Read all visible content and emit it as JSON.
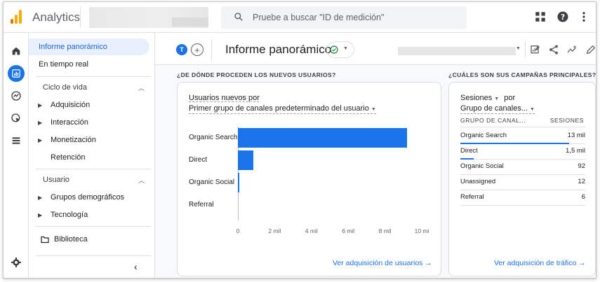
{
  "app": {
    "name": "Analytics"
  },
  "search": {
    "placeholder": "Pruebe a buscar \"ID de medición\""
  },
  "nav": {
    "overview": "Informe panorámico",
    "realtime": "En tiempo real",
    "lifecycle": "Ciclo de vida",
    "acquisition": "Adquisición",
    "engagement": "Interacción",
    "monetization": "Monetización",
    "retention": "Retención",
    "user": "Usuario",
    "demographics": "Grupos demográficos",
    "tech": "Tecnología",
    "library": "Biblioteca"
  },
  "report": {
    "badge": "T",
    "title": "Informe panorámico"
  },
  "sections": {
    "left": "¿DE DÓNDE PROCEDEN LOS NUEVOS USUARIOS?",
    "right": "¿CUÁLES SON SUS CAMPAÑAS PRINCIPALES?"
  },
  "card1": {
    "title": "Usuarios nuevos por",
    "subtitle": "Primer grupo de canales predeterminado del usuario",
    "link": "Ver adquisición de usuarios  →"
  },
  "chart_data": {
    "type": "bar",
    "orientation": "horizontal",
    "categories": [
      "Organic Search",
      "Direct",
      "Organic Social",
      "Referral"
    ],
    "values": [
      9200,
      850,
      90,
      10
    ],
    "xlim": [
      0,
      10000
    ],
    "tick_labels": [
      "0",
      "2 mil",
      "4 mil",
      "6 mil",
      "8 mil",
      "10 mi"
    ],
    "color": "#1a73e8"
  },
  "card2": {
    "title": "Sesiones",
    "title_suffix": "por",
    "subtitle": "Grupo de canales...",
    "col_channel": "GRUPO DE CANAL...",
    "col_sessions": "SESIONES",
    "rows": [
      {
        "name": "Organic Search",
        "value": "13 mil",
        "share": 1.0
      },
      {
        "name": "Direct",
        "value": "1,5 mil",
        "share": 0.12
      },
      {
        "name": "Organic Social",
        "value": "92",
        "share": 0
      },
      {
        "name": "Unassigned",
        "value": "12",
        "share": 0
      },
      {
        "name": "Referral",
        "value": "6",
        "share": 0
      }
    ],
    "link": "Ver adquisición de tráfico  →"
  },
  "colors": {
    "accent": "#1a73e8",
    "logo_orange": "#f9ab00",
    "logo_dark": "#e37400"
  }
}
